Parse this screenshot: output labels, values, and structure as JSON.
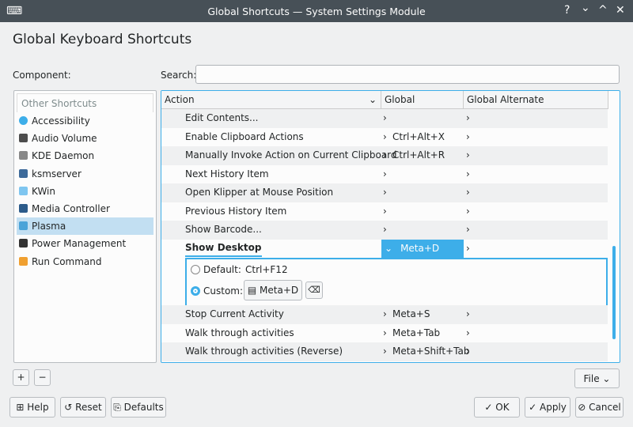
{
  "window": {
    "title": "Global Shortcuts — System Settings Module",
    "controls": [
      "?",
      "⌄",
      "^",
      "✕"
    ]
  },
  "heading": "Global Keyboard Shortcuts",
  "component_label": "Component:",
  "search": {
    "label": "Search:",
    "value": "",
    "placeholder": ""
  },
  "components": {
    "header": "Other Shortcuts",
    "items": [
      {
        "label": "Accessibility",
        "icon": "accessibility-icon",
        "color": "#3daee9"
      },
      {
        "label": "Audio Volume",
        "icon": "audio-volume-icon",
        "color": "#4d4d4d"
      },
      {
        "label": "KDE Daemon",
        "icon": "kde-daemon-icon",
        "color": "#888"
      },
      {
        "label": "ksmserver",
        "icon": "ksmserver-icon",
        "color": "#3d6a9a"
      },
      {
        "label": "KWin",
        "icon": "kwin-icon",
        "color": "#7fc6f0"
      },
      {
        "label": "Media Controller",
        "icon": "media-controller-icon",
        "color": "#2c5b8a"
      },
      {
        "label": "Plasma",
        "icon": "plasma-icon",
        "color": "#4aa3d8"
      },
      {
        "label": "Power Management",
        "icon": "power-management-icon",
        "color": "#333"
      },
      {
        "label": "Run Command",
        "icon": "run-command-icon",
        "color": "#f0a030"
      }
    ]
  },
  "table": {
    "columns": [
      "Action",
      "Global",
      "Global Alternate"
    ],
    "rows_before": [
      {
        "action": "Edit Contents...",
        "global": ""
      },
      {
        "action": "Enable Clipboard Actions",
        "global": "Ctrl+Alt+X"
      },
      {
        "action": "Manually Invoke Action on Current Clipboard",
        "global": "Ctrl+Alt+R"
      },
      {
        "action": "Next History Item",
        "global": ""
      },
      {
        "action": "Open Klipper at Mouse Position",
        "global": ""
      },
      {
        "action": "Previous History Item",
        "global": ""
      },
      {
        "action": "Show Barcode...",
        "global": ""
      }
    ],
    "expanded": {
      "action": "Show Desktop",
      "global": "Meta+D",
      "default_label": "Default:",
      "default_value": "Ctrl+F12",
      "custom_label": "Custom:",
      "custom_value": "Meta+D"
    },
    "rows_after": [
      {
        "action": "Stop Current Activity",
        "global": "Meta+S"
      },
      {
        "action": "Walk through activities",
        "global": "Meta+Tab"
      },
      {
        "action": "Walk through activities (Reverse)",
        "global": "Meta+Shift+Tab"
      }
    ]
  },
  "buttons": {
    "add": "+",
    "remove": "−",
    "file": "File",
    "help": "Help",
    "reset": "Reset",
    "defaults": "Defaults",
    "ok": "OK",
    "apply": "Apply",
    "cancel": "Cancel"
  },
  "accent": "#3daee9"
}
